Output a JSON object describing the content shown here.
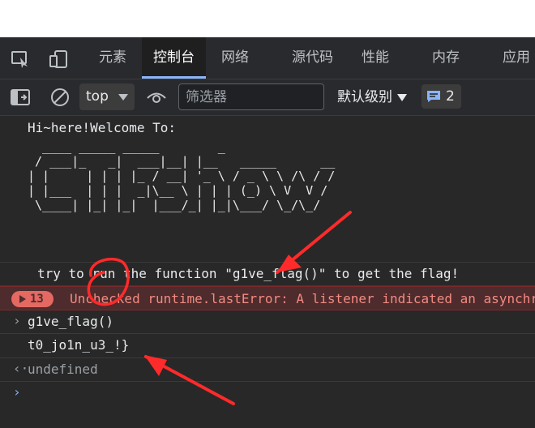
{
  "tabs": [
    {
      "label": "元素"
    },
    {
      "label": "控制台"
    },
    {
      "label": "网络"
    },
    {
      "label": "源代码"
    },
    {
      "label": "性能"
    },
    {
      "label": "内存"
    },
    {
      "label": "应用"
    }
  ],
  "toolbar": {
    "context": "top",
    "filter_placeholder": "筛选器",
    "levels": "默认级别",
    "message_count": "2"
  },
  "console": {
    "greeting": "Hi~here!Welcome To:",
    "ascii_art": "  ____ _____ _____        _\n / ___|_   _|  ___|__| |__   _____      __\n| |     | | | |_ / __| '_ \\ / _ \\ \\ /\\ / /\n| |___  | | |  _|\\__ \\ | | | (_) \\ V  V /\n \\____| |_| |_|  |___/_| |_|\\___/ \\_/\\_/",
    "hint": "try to run the function \"g1ve_flag()\" to get the flag!",
    "error_count": "13",
    "error_message": "Unchecked runtime.lastError: A listener indicated an asynchronous response",
    "input": "g1ve_flag()",
    "output": "t0_jo1n_u3_!}",
    "result": "undefined"
  },
  "colors": {
    "background": "#282828",
    "error_bg": "#4e2b2c",
    "error_text": "#f28b82",
    "accent": "#8ab4f8",
    "annotation": "#ff2a2a"
  }
}
